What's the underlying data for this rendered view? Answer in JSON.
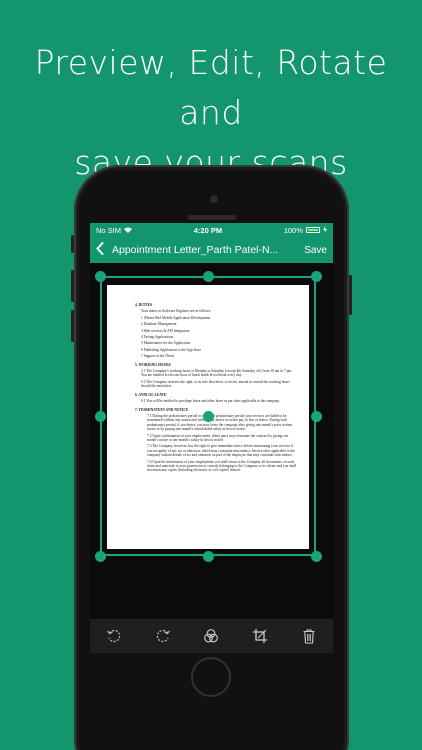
{
  "headline": {
    "line1": "Preview, Edit, Rotate and",
    "line2": "save your scans"
  },
  "status_bar": {
    "carrier": "No SIM",
    "time": "4:20 PM",
    "battery": "100%"
  },
  "nav": {
    "back_label": "‹",
    "title": "Appointment Letter_Parth Patel-N...",
    "save_label": "Save"
  },
  "document": {
    "s4_title": "4.   DUTIES",
    "s4_intro": "Your duties as Software Engineer are as follows:",
    "s4_items": [
      "1  iPhone/iPad Mobile Application Development",
      "2  Database Management",
      "3  Web services & API Integration",
      "4  Testing Applications",
      "5  Maintenance for the Application",
      "6  Publishing Application to the App Store",
      "7  Support to the Client"
    ],
    "s5_title": "5.   WORKING HOURS",
    "s5_p1": "5.1 The Company's working hours is Monday to Saturday (except 4th Saturday, off) from 10 am to 7 pm. You are entitled to rest one hour of lunch break & tea break every day.",
    "s5_p2": "5.2 The Company reserves the right, at its sole discretion, to revise, amend or extend the working hours should the need arise.",
    "s6_title": "6.   ANNUAL LEAVE",
    "s6_p1": "6.1 You will be entitled to privilege leave and other leave as per rules applicable to the company.",
    "s7_title": "7.   TERMINATION AND NOTICE",
    "s7_p1": "7.1  During the probationary period or extended probationary period your services are liable to be terminated without any reason and without any notice or notice pay in lieu of notice. During such probationary period, if you desire, you may leave the company after giving one month's prior written notice or by paying one month's consolidated salary in lieu of notice.",
    "s7_p2": "7.2  Upon confirmation of your employment, either party may terminate the contract by giving one month's notice or one month's salary in lieu of notice.",
    "s7_p3": "7.3  The Company, however, has the right to give immediate notice before terminating your services if you are guilty of any act or omission, which may constitute misconduct. Service rules applicable to the company contain details of act and omission on part of the employee that may constitute misconduct.",
    "s7_p4": "7.4  Upon the termination of your employment you shall return to the Company all documents, records, items and materials in your possession or custody belonging to the Company or its clients and you shall not retain any copies (including electronic or soft copies) thereof."
  },
  "toolbar": {
    "icons": [
      "rotate-left-icon",
      "rotate-right-icon",
      "color-filter-icon",
      "crop-icon",
      "trash-icon"
    ]
  },
  "colors": {
    "brand": "#13956e",
    "handle": "#19a57c",
    "toolbar": "#1f1f1f"
  }
}
